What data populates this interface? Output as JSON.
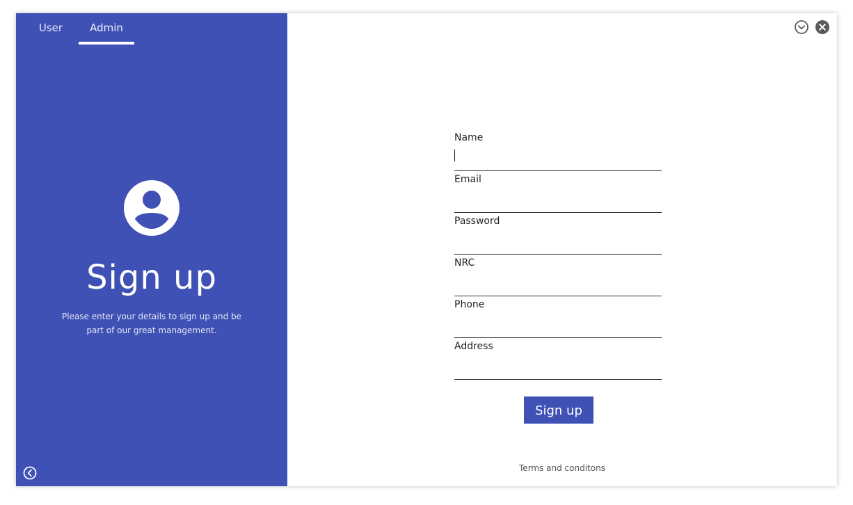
{
  "tabs": {
    "user_label": "User",
    "admin_label": "Admin",
    "active": "Admin"
  },
  "left": {
    "heading": "Sign up",
    "subtitle": "Please enter your details to sign up and be part of our great management."
  },
  "form": {
    "fields": [
      {
        "label": "Name",
        "value": ""
      },
      {
        "label": "Email",
        "value": ""
      },
      {
        "label": "Password",
        "value": ""
      },
      {
        "label": "NRC",
        "value": ""
      },
      {
        "label": "Phone",
        "value": ""
      },
      {
        "label": "Address",
        "value": ""
      }
    ],
    "submit_label": "Sign up",
    "terms_label": "Terms and conditons"
  },
  "icons": {
    "avatar": "account-circle-icon",
    "back": "chevron-left-circle-icon",
    "minimize": "chevron-down-circle-icon",
    "close": "close-circle-icon"
  },
  "colors": {
    "primary": "#3f51b5",
    "on_primary": "#ffffff",
    "window_control": "#5a5a5a"
  }
}
